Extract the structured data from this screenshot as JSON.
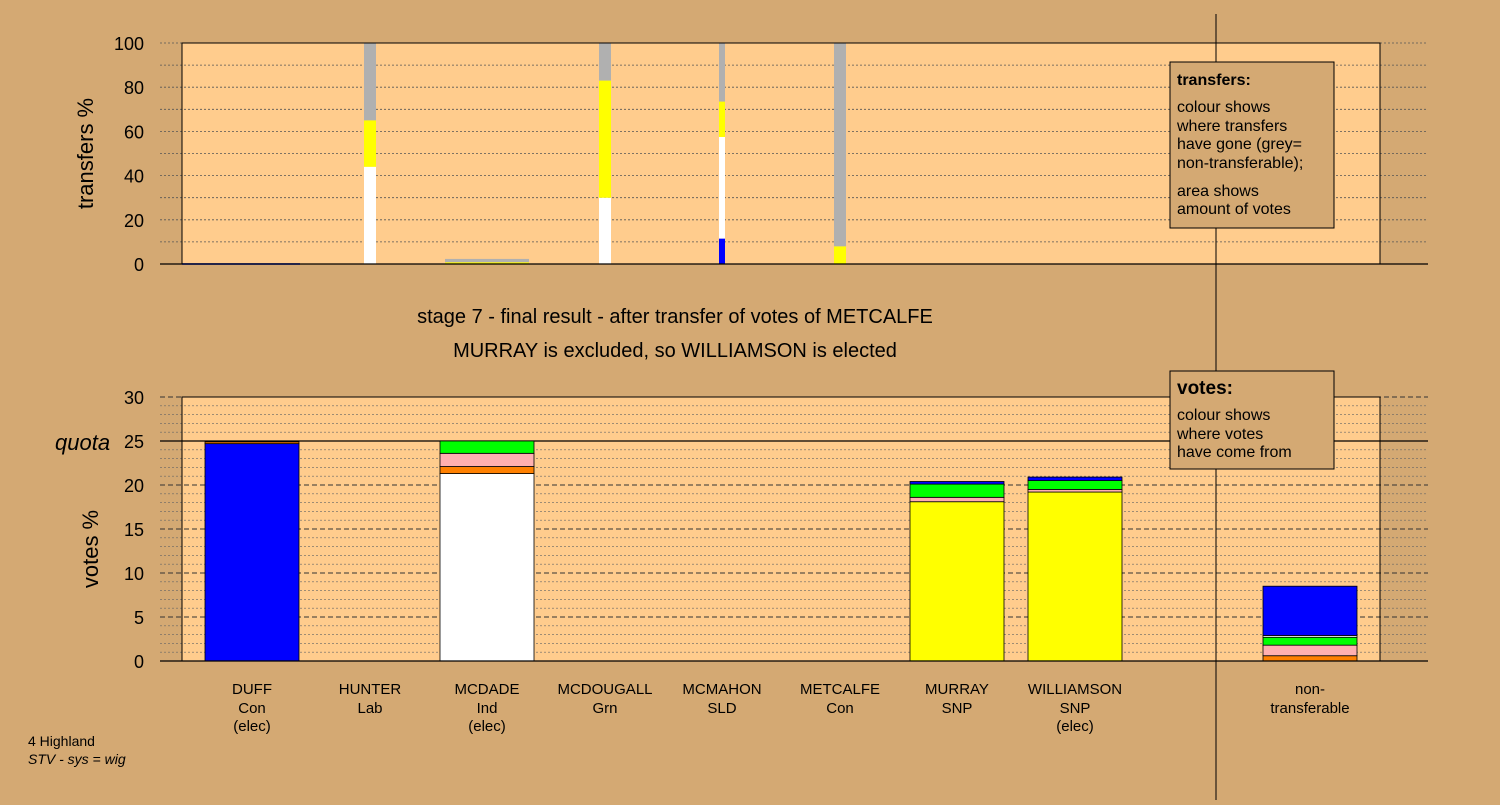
{
  "chart_data": [
    {
      "type": "bar",
      "stacked": true,
      "ylabel": "transfers %",
      "ylim": [
        0,
        100
      ],
      "yticks": [
        0,
        20,
        40,
        60,
        80,
        100
      ],
      "grid": true,
      "bars": [
        {
          "name": "transfer-bar-1",
          "width": "narrow",
          "segments": [
            {
              "color": "#ffffff",
              "value": 44
            },
            {
              "color": "#ffff00",
              "value": 21
            },
            {
              "color": "#b0b0b0",
              "value": 35
            }
          ]
        },
        {
          "name": "transfer-bar-mcdade",
          "width": "wide",
          "segments": [
            {
              "color": "#ffff00",
              "value": 0.8
            },
            {
              "color": "#b0b0b0",
              "value": 1.5
            }
          ]
        },
        {
          "name": "transfer-bar-3",
          "width": "narrow",
          "segments": [
            {
              "color": "#ffffff",
              "value": 30
            },
            {
              "color": "#ffff00",
              "value": 53
            },
            {
              "color": "#b0b0b0",
              "value": 17
            }
          ]
        },
        {
          "name": "transfer-bar-4",
          "width": "thin",
          "segments": [
            {
              "color": "#0000ff",
              "value": 11.5
            },
            {
              "color": "#ffffff",
              "value": 46
            },
            {
              "color": "#ffff00",
              "value": 16
            },
            {
              "color": "#b0b0b0",
              "value": 26.5
            }
          ]
        },
        {
          "name": "transfer-bar-5",
          "width": "narrow",
          "segments": [
            {
              "color": "#ffff00",
              "value": 8
            },
            {
              "color": "#b0b0b0",
              "value": 92
            }
          ]
        }
      ]
    },
    {
      "type": "bar",
      "stacked": true,
      "ylabel": "votes %",
      "ylim": [
        0,
        30
      ],
      "yticks": [
        0,
        5,
        10,
        15,
        20,
        25,
        30
      ],
      "quota": 25,
      "quota_label": "quota",
      "grid": true,
      "categories": [
        {
          "name": "DUFF",
          "party": "Con",
          "status": "(elec)"
        },
        {
          "name": "HUNTER",
          "party": "Lab",
          "status": ""
        },
        {
          "name": "MCDADE",
          "party": "Ind",
          "status": "(elec)"
        },
        {
          "name": "MCDOUGALL",
          "party": "Grn",
          "status": ""
        },
        {
          "name": "MCMAHON",
          "party": "SLD",
          "status": ""
        },
        {
          "name": "METCALFE",
          "party": "Con",
          "status": ""
        },
        {
          "name": "MURRAY",
          "party": "SNP",
          "status": ""
        },
        {
          "name": "WILLIAMSON",
          "party": "SNP",
          "status": "(elec)"
        },
        {
          "name": "non-",
          "party": "transferable",
          "status": ""
        }
      ],
      "bars": [
        [
          {
            "color": "#0000ff",
            "value": 24.7
          },
          {
            "color": "#ff8000",
            "value": 0.2
          }
        ],
        [],
        [
          {
            "color": "#ffffff",
            "value": 21.3
          },
          {
            "color": "#ff8000",
            "value": 0.8
          },
          {
            "color": "#ffb0b0",
            "value": 1.5
          },
          {
            "color": "#00ff00",
            "value": 1.4
          }
        ],
        [],
        [],
        [],
        [
          {
            "color": "#ffff00",
            "value": 18.1
          },
          {
            "color": "#ffb0b0",
            "value": 0.5
          },
          {
            "color": "#00ff00",
            "value": 1.5
          },
          {
            "color": "#0000ff",
            "value": 0.3
          }
        ],
        [
          {
            "color": "#ffff00",
            "value": 19.2
          },
          {
            "color": "#ffb0b0",
            "value": 0.3
          },
          {
            "color": "#00ff00",
            "value": 1
          },
          {
            "color": "#0000ff",
            "value": 0.4
          }
        ],
        [
          {
            "color": "#ff8000",
            "value": 0.6
          },
          {
            "color": "#ffb0b0",
            "value": 1.2
          },
          {
            "color": "#00ff00",
            "value": 0.9
          },
          {
            "color": "#ffffff",
            "value": 0.2
          },
          {
            "color": "#0000ff",
            "value": 5.6
          }
        ]
      ]
    }
  ],
  "stage_title": "stage 7 - final result - after transfer of votes of METCALFE",
  "stage_subtitle": "MURRAY is excluded, so WILLIAMSON is elected",
  "transfers_legend": {
    "title": "transfers:",
    "lines": [
      "colour shows",
      "where transfers",
      "have gone (grey=",
      "non-transferable);",
      "area shows",
      "amount of votes"
    ]
  },
  "votes_legend": {
    "title": "votes:",
    "lines": [
      "colour shows",
      "where votes",
      "have come from"
    ]
  },
  "footer": {
    "region": "4 Highland",
    "system": "STV - sys = wig"
  },
  "colors": {
    "background": "#d4a973",
    "plot_area": "#ffcc8d",
    "legend_box": "#d4a973"
  }
}
